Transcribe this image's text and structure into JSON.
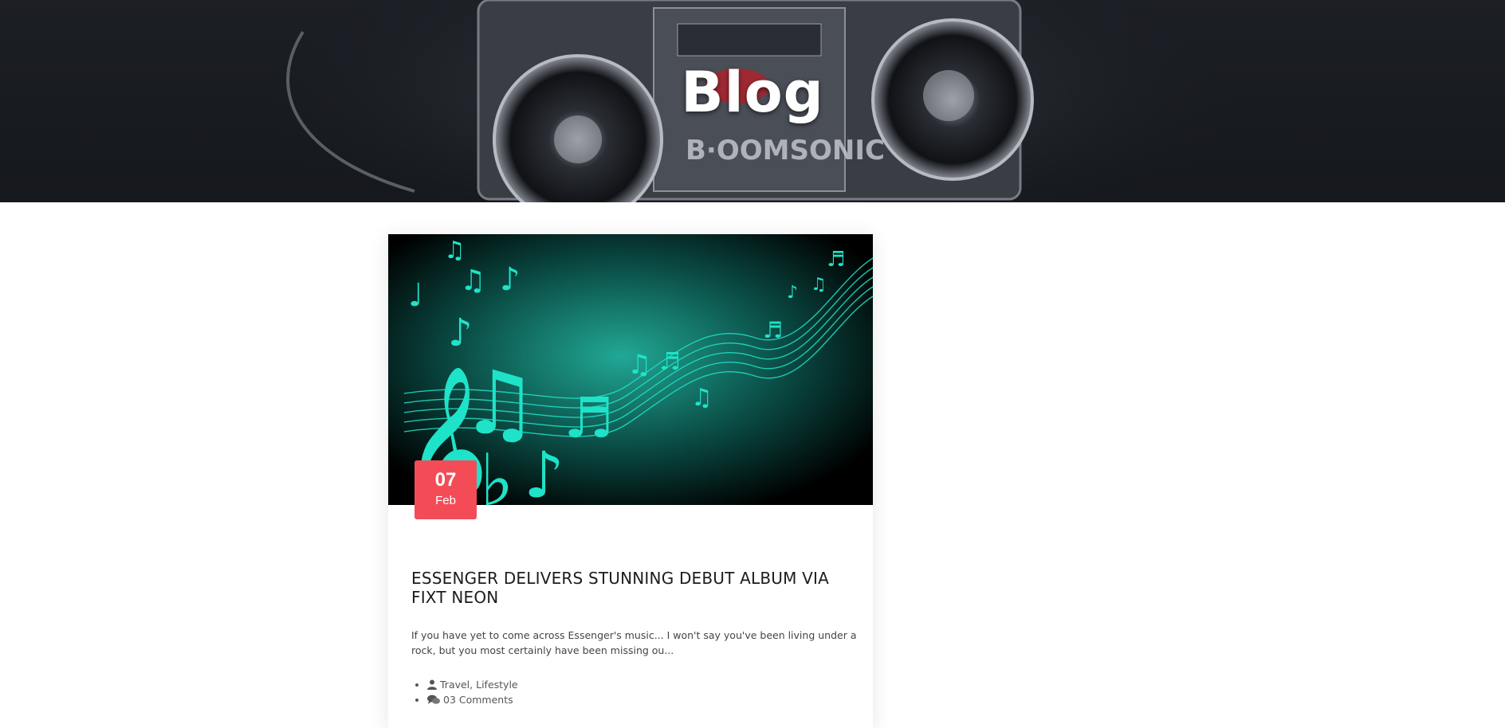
{
  "header": {
    "title": "Blog",
    "background_image": "boombox-graffiti-image"
  },
  "post": {
    "image": "music-notes-teal-image",
    "date_day": "07",
    "date_month": "Feb",
    "title": "ESSENGER DELIVERS STUNNING DEBUT ALBUM VIA FIXT NEON",
    "excerpt": "If you have yet to come across Essenger's music... I won't say you've been living under a rock, but you most certainly have been missing ou...",
    "categories": "Travel, Lifestyle",
    "comments": "03 Comments",
    "categories_icon": "user-icon",
    "comments_icon": "comments-icon"
  },
  "colors": {
    "badge": "#f44c57",
    "accent_teal": "#1ee3c8",
    "hero_bg": "#1c1f25"
  }
}
